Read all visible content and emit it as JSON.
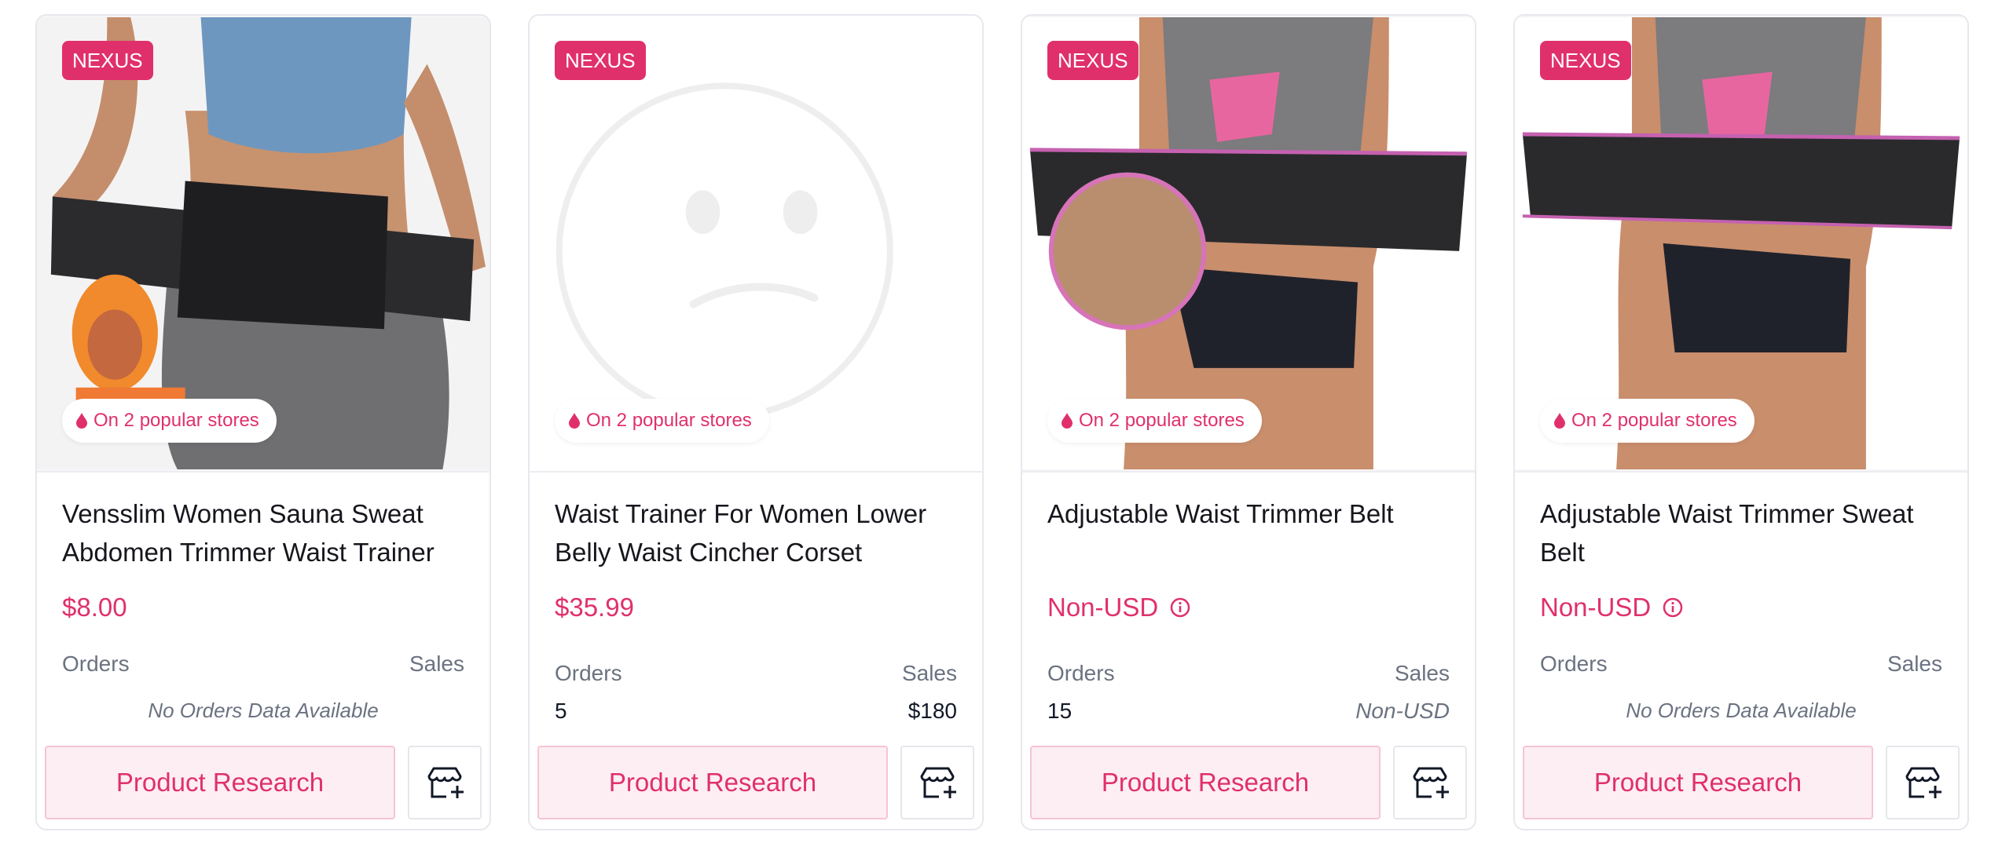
{
  "colors": {
    "accent": "#e0306c",
    "accent_bg": "#fdeef3",
    "muted": "#6b7280"
  },
  "cards": [
    {
      "badge": "NEXUS",
      "popular": "On 2 popular stores",
      "title": "Vensslim Women Sauna Sweat Abdomen Trimmer Waist Trainer",
      "price": "$8.00",
      "orders_label": "Orders",
      "sales_label": "Sales",
      "no_data": "No Orders Data Available",
      "research_label": "Product Research",
      "image": "woman-waist-trainer-photo"
    },
    {
      "badge": "NEXUS",
      "popular": "On 2 popular stores",
      "title": "Waist Trainer For Women Lower Belly Waist Cincher Corset",
      "price": "$35.99",
      "orders_label": "Orders",
      "sales_label": "Sales",
      "orders_value": "5",
      "sales_value": "$180",
      "research_label": "Product Research",
      "image": "sad-face-placeholder"
    },
    {
      "badge": "NEXUS",
      "popular": "On 2 popular stores",
      "title": "Adjustable Waist Trimmer Belt",
      "price": "Non-USD",
      "orders_label": "Orders",
      "sales_label": "Sales",
      "orders_value": "15",
      "sales_value": "Non-USD",
      "research_label": "Product Research",
      "image": "woman-trimmer-belt-photo"
    },
    {
      "badge": "NEXUS",
      "popular": "On 2 popular stores",
      "title": "Adjustable Waist Trimmer Sweat Belt",
      "price": "Non-USD",
      "orders_label": "Orders",
      "sales_label": "Sales",
      "no_data": "No Orders Data Available",
      "research_label": "Product Research",
      "image": "woman-sweat-belt-photo"
    }
  ]
}
